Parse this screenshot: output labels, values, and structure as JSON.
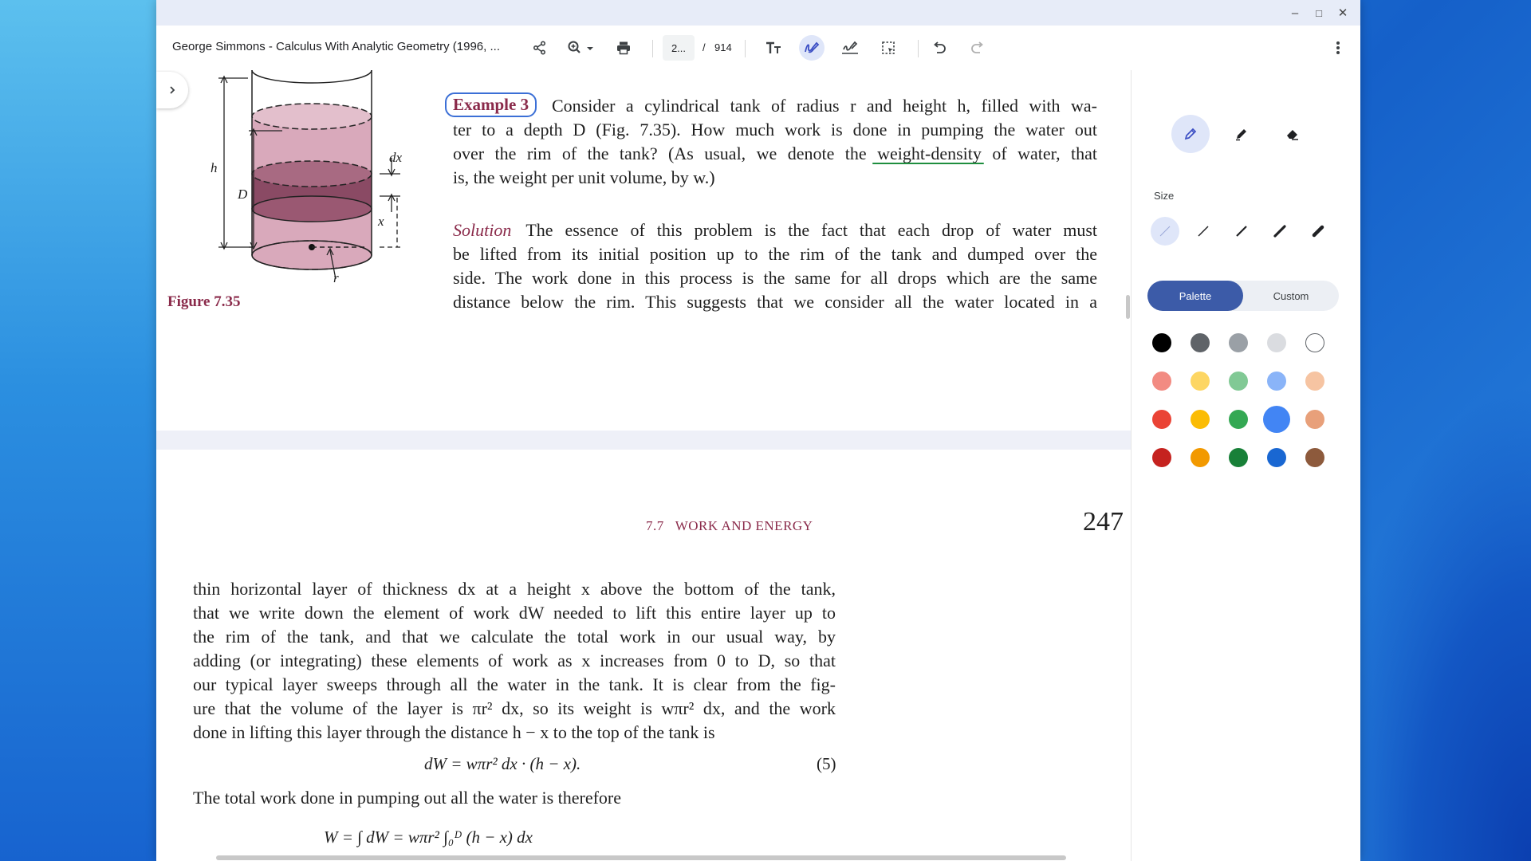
{
  "window": {
    "minimize_glyph": "–",
    "maximize_glyph": "□",
    "close_glyph": "✕"
  },
  "toolbar": {
    "doc_title": "George Simmons - Calculus With Analytic Geometry (1996, ...",
    "page_current": "2...",
    "page_sep": "/",
    "page_total": "914",
    "icons": [
      "share-icon",
      "zoom-icon",
      "print-icon",
      "text-icon",
      "draw-icon",
      "signature-icon",
      "select-icon",
      "undo-icon",
      "redo-icon",
      "more-icon"
    ]
  },
  "document": {
    "example_label": "Example 3",
    "example_lines": [
      "Consider a cylindrical tank of radius r and height h, filled with wa-",
      "ter to a depth D (Fig. 7.35). How much work is done in pumping the water out",
      "over the rim of the tank? (As usual, we denote the weight-density of water, that",
      "is, the weight per unit volume, by w.)"
    ],
    "solution_label": "Solution",
    "solution_lines": [
      "The essence of this problem is the fact that each drop of water must",
      "be lifted from its initial position up to the rim of the tank and dumped over the",
      "side. The work done in this process is the same for all drops which are the same",
      "distance below the rim. This suggests that we consider all the water located in a"
    ],
    "figure_caption": "Figure 7.35",
    "figure_labels": {
      "h": "h",
      "D": "D",
      "dx": "dx",
      "x": "x",
      "r": "r"
    },
    "running_head": "7.7   WORK AND ENERGY",
    "page_number": "247",
    "body_lines": [
      "thin horizontal layer of thickness dx at a height x above the bottom of the tank,",
      "that we write down the element of work dW needed to lift this entire layer up to",
      "the rim of the tank, and that we calculate the total work in our usual way, by",
      "adding (or integrating) these elements of work as x increases from 0 to D, so that",
      "our typical layer sweeps through all the water in the tank. It is clear from the fig-",
      "ure that the volume of the layer is πr² dx, so its weight is wπr² dx, and the work",
      "done in lifting this layer through the distance h − x to the top of the tank is"
    ],
    "equation": "dW = wπr² dx · (h − x).",
    "equation_number": "(5)",
    "total_line": "The total work done in pumping out all the water is therefore",
    "integral_line": "W = ∫ dW = wπr² ∫₀ᴰ (h − x) dx"
  },
  "panel": {
    "size_label": "Size",
    "tab_palette": "Palette",
    "tab_custom": "Custom",
    "tools": [
      "pen-icon",
      "highlighter-icon",
      "eraser-icon"
    ],
    "selected_tool": "pen-icon",
    "sizes": 5,
    "selected_size": 0,
    "colors": [
      [
        "#000000",
        "#5f6368",
        "#9aa0a6",
        "#dadce0",
        "#ffffff"
      ],
      [
        "#f28b82",
        "#fdd663",
        "#81c995",
        "#8ab4f8",
        "#f6c4a2"
      ],
      [
        "#ea4335",
        "#fbbc04",
        "#34a853",
        "#4285f4",
        "#e8a07a"
      ],
      [
        "#c5221f",
        "#f29900",
        "#188038",
        "#1967d2",
        "#8d5a3c"
      ]
    ],
    "selected_color": "#4285f4"
  }
}
